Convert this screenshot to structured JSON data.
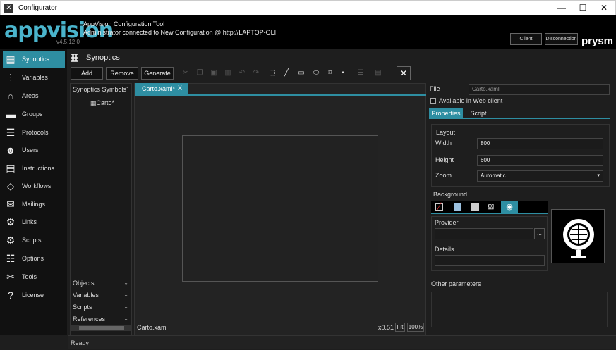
{
  "window": {
    "title": "Configurator",
    "min": "—",
    "max": "☐",
    "close": "✕"
  },
  "header": {
    "logo": "appvision",
    "version": "v4.5.12.0",
    "tool_title": "AppVision Configuration Tool",
    "connection": "Administrator connected to New Configuration @ http://LAPTOP-OLI",
    "client_button": "Client",
    "disconnect_button": "Disconnection",
    "brand": "prysm"
  },
  "sidebar": {
    "items": [
      {
        "label": "Synoptics",
        "icon": "map-icon"
      },
      {
        "label": "Variables",
        "icon": "sliders-icon"
      },
      {
        "label": "Areas",
        "icon": "home-icon"
      },
      {
        "label": "Groups",
        "icon": "folder-icon"
      },
      {
        "label": "Protocols",
        "icon": "network-icon"
      },
      {
        "label": "Users",
        "icon": "users-icon"
      },
      {
        "label": "Instructions",
        "icon": "clipboard-icon"
      },
      {
        "label": "Workflows",
        "icon": "workflow-icon"
      },
      {
        "label": "Mailings",
        "icon": "mail-icon"
      },
      {
        "label": "Links",
        "icon": "gears-icon"
      },
      {
        "label": "Scripts",
        "icon": "script-icon"
      },
      {
        "label": "Options",
        "icon": "list-icon"
      },
      {
        "label": "Tools",
        "icon": "tools-icon"
      },
      {
        "label": "License",
        "icon": "help-icon"
      }
    ]
  },
  "main": {
    "title": "Synoptics",
    "add": "Add",
    "remove": "Remove",
    "generate": "Generate"
  },
  "left_panel": {
    "header": "Synoptics Symbols",
    "item": "Carto*",
    "sections": [
      "Objects",
      "Variables",
      "Scripts",
      "References"
    ]
  },
  "editor": {
    "tab": "Carto.xaml*",
    "tab_close": "X",
    "filename": "Carto.xaml",
    "zoom": "x0.51",
    "fit": "Fit",
    "percent": "100%"
  },
  "properties": {
    "file_label": "File",
    "file_value": "Carto.xaml",
    "web_client": "Available in Web client",
    "tabs": [
      "Properties",
      "Script"
    ],
    "layout_label": "Layout",
    "width_label": "Width",
    "width_value": "800",
    "height_label": "Height",
    "height_value": "600",
    "zoom_label": "Zoom",
    "zoom_value": "Automatic",
    "background_label": "Background",
    "provider_label": "Provider",
    "provider_btn": "...",
    "details_label": "Details",
    "other_label": "Other parameters"
  },
  "status": "Ready"
}
